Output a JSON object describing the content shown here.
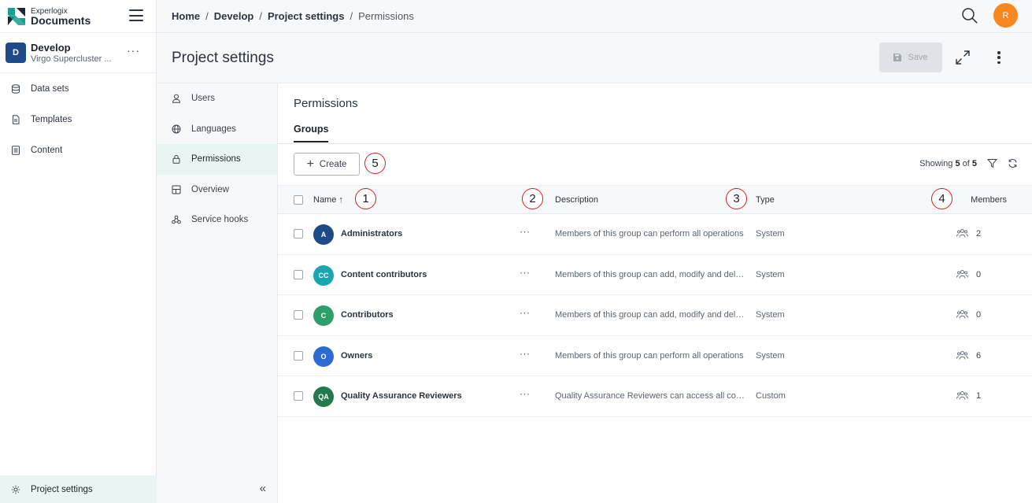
{
  "brand": {
    "top_line": "Experlogix",
    "bottom_line": "Documents",
    "logo_colors": [
      "#1a9e8f",
      "#1d2a3a"
    ]
  },
  "project": {
    "initial": "D",
    "name": "Develop",
    "subtitle": "Virgo Supercluster ...",
    "more": "···"
  },
  "sidebar": {
    "items": [
      {
        "label": "Data sets",
        "icon": "database-icon"
      },
      {
        "label": "Templates",
        "icon": "document-icon"
      },
      {
        "label": "Content",
        "icon": "content-icon"
      }
    ],
    "bottom_item": {
      "label": "Project settings",
      "icon": "gear-icon"
    }
  },
  "breadcrumb": [
    {
      "label": "Home"
    },
    {
      "label": "Develop"
    },
    {
      "label": "Project settings"
    },
    {
      "label": "Permissions"
    }
  ],
  "breadcrumb_separator": "/",
  "user": {
    "initial": "R",
    "color": "#f7871f"
  },
  "header": {
    "title": "Project settings",
    "save_label": "Save"
  },
  "settings_nav": [
    {
      "label": "Users",
      "icon": "user-icon"
    },
    {
      "label": "Languages",
      "icon": "globe-icon"
    },
    {
      "label": "Permissions",
      "icon": "lock-icon",
      "active": true
    },
    {
      "label": "Overview",
      "icon": "grid-icon"
    },
    {
      "label": "Service hooks",
      "icon": "webhook-icon"
    }
  ],
  "collapse_glyph": "«",
  "main": {
    "section_title": "Permissions",
    "tab": "Groups",
    "create_label": "Create",
    "showing": {
      "prefix": "Showing",
      "count": "5",
      "of": "of",
      "total": "5"
    },
    "columns": {
      "name": "Name",
      "sort_arrow": "↑",
      "description": "Description",
      "type": "Type",
      "members": "Members"
    },
    "rows": [
      {
        "initials": "A",
        "color": "#1e4a8a",
        "name": "Administrators",
        "description": "Members of this group can perform all operations",
        "type": "System",
        "members": "2"
      },
      {
        "initials": "CC",
        "color": "#1aa6b0",
        "name": "Content contributors",
        "description": "Members of this group can add, modify and delete content",
        "type": "System",
        "members": "0"
      },
      {
        "initials": "C",
        "color": "#2e9e6a",
        "name": "Contributors",
        "description": "Members of this group can add, modify and delete items",
        "type": "System",
        "members": "0"
      },
      {
        "initials": "O",
        "color": "#2c6bd1",
        "name": "Owners",
        "description": "Members of this group can perform all operations",
        "type": "System",
        "members": "6"
      },
      {
        "initials": "QA",
        "color": "#237a4e",
        "name": "Quality Assurance Reviewers",
        "description": "Quality Assurance Reviewers can access all content",
        "type": "Custom",
        "members": "1"
      }
    ],
    "row_more": "···"
  },
  "markers": [
    "1",
    "2",
    "3",
    "4",
    "5"
  ]
}
